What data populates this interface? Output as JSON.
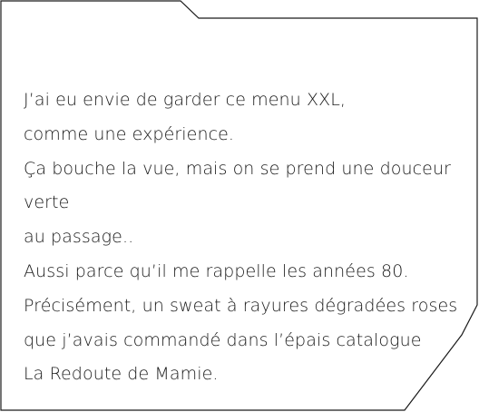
{
  "note": {
    "lines": [
      "J’ai eu envie de garder ce menu XXL,",
      "comme une expérience.",
      "Ça bouche la vue, mais on se prend une douceur",
      "verte",
      "au passage..",
      "Aussi parce qu’il me rappelle les années 80.",
      "Précisément, un sweat à rayures dégradées roses",
      "que j’avais commandé dans l’épais catalogue",
      "La Redoute de Mamie."
    ]
  },
  "colors": {
    "text": "#1a1a1a",
    "border": "#1a1a1a",
    "background": "#ffffff"
  }
}
